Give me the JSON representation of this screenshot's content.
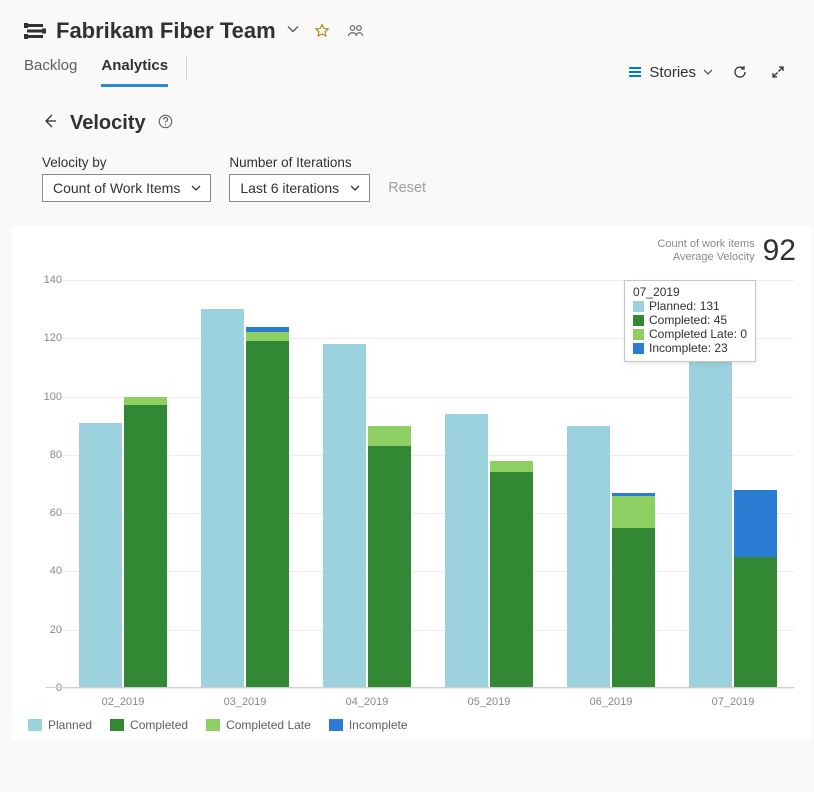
{
  "header": {
    "team_name": "Fabrikam Fiber Team"
  },
  "tabs": {
    "backlog": "Backlog",
    "analytics": "Analytics"
  },
  "stories_dropdown": "Stories",
  "page": {
    "title": "Velocity"
  },
  "controls": {
    "velocity_by_label": "Velocity by",
    "velocity_by_value": "Count of Work Items",
    "iterations_label": "Number of Iterations",
    "iterations_value": "Last 6 iterations",
    "reset": "Reset"
  },
  "summary": {
    "line1": "Count of work items",
    "line2": "Average Velocity",
    "value": "92"
  },
  "legend": {
    "planned": "Planned",
    "completed": "Completed",
    "late": "Completed Late",
    "incomplete": "Incomplete"
  },
  "tooltip": {
    "title": "07_2019",
    "planned": "Planned: 131",
    "completed": "Completed: 45",
    "late": "Completed Late: 0",
    "incomplete": "Incomplete: 23"
  },
  "chart_data": {
    "type": "bar",
    "title": "Velocity",
    "xlabel": "",
    "ylabel": "",
    "ylim": [
      0,
      140
    ],
    "yticks": [
      0,
      20,
      40,
      60,
      80,
      100,
      120,
      140
    ],
    "categories": [
      "02_2019",
      "03_2019",
      "04_2019",
      "05_2019",
      "06_2019",
      "07_2019"
    ],
    "series": [
      {
        "name": "Planned",
        "color": "#9cd1de",
        "values": [
          91,
          130,
          118,
          94,
          90,
          131
        ]
      },
      {
        "name": "Completed",
        "color": "#338933",
        "values": [
          97,
          119,
          83,
          74,
          55,
          45
        ]
      },
      {
        "name": "Completed Late",
        "color": "#8dcf63",
        "values": [
          3,
          3,
          7,
          4,
          11,
          0
        ]
      },
      {
        "name": "Incomplete",
        "color": "#2b7cd3",
        "values": [
          0,
          2,
          0,
          0,
          1,
          23
        ]
      }
    ],
    "note": "Second bar in each group is a stack of Completed + Completed Late + Incomplete; first bar is Planned alone."
  }
}
